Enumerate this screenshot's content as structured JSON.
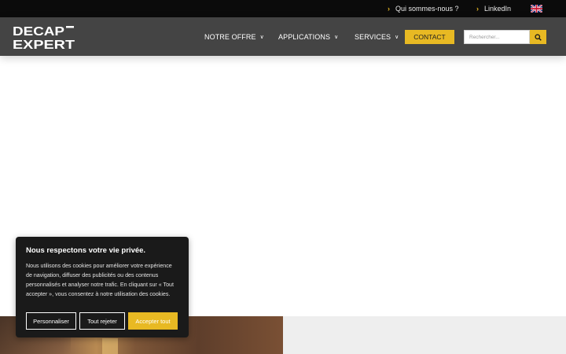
{
  "topbar": {
    "links": [
      {
        "label": "Qui sommes-nous ?",
        "icon": "chevron-right-icon"
      },
      {
        "label": "LinkedIn",
        "icon": "chevron-right-icon"
      }
    ],
    "language_flag": "uk-flag-icon"
  },
  "header": {
    "logo_line1": "DECAP",
    "logo_line2": "EXPERT",
    "nav": [
      {
        "label": "NOTRE OFFRE"
      },
      {
        "label": "APPLICATIONS"
      },
      {
        "label": "SERVICES"
      }
    ],
    "contact_label": "CONTACT",
    "search_placeholder": "Rechercher..."
  },
  "cookie_banner": {
    "title": "Nous respectons votre vie privée.",
    "text": "Nous utilisons des cookies pour améliorer votre expérience de navigation, diffuser des publicités ou des contenus personnalisés et analyser notre trafic. En cliquant sur « Tout accepter », vous consentez à notre utilisation des cookies.",
    "customize_label": "Personnaliser",
    "reject_label": "Tout rejeter",
    "accept_label": "Accepter tout"
  },
  "colors": {
    "accent": "#e8b923",
    "nav_bg": "#444444",
    "topbar_bg": "#0b0b0b",
    "banner_bg": "#1a1a1a"
  }
}
